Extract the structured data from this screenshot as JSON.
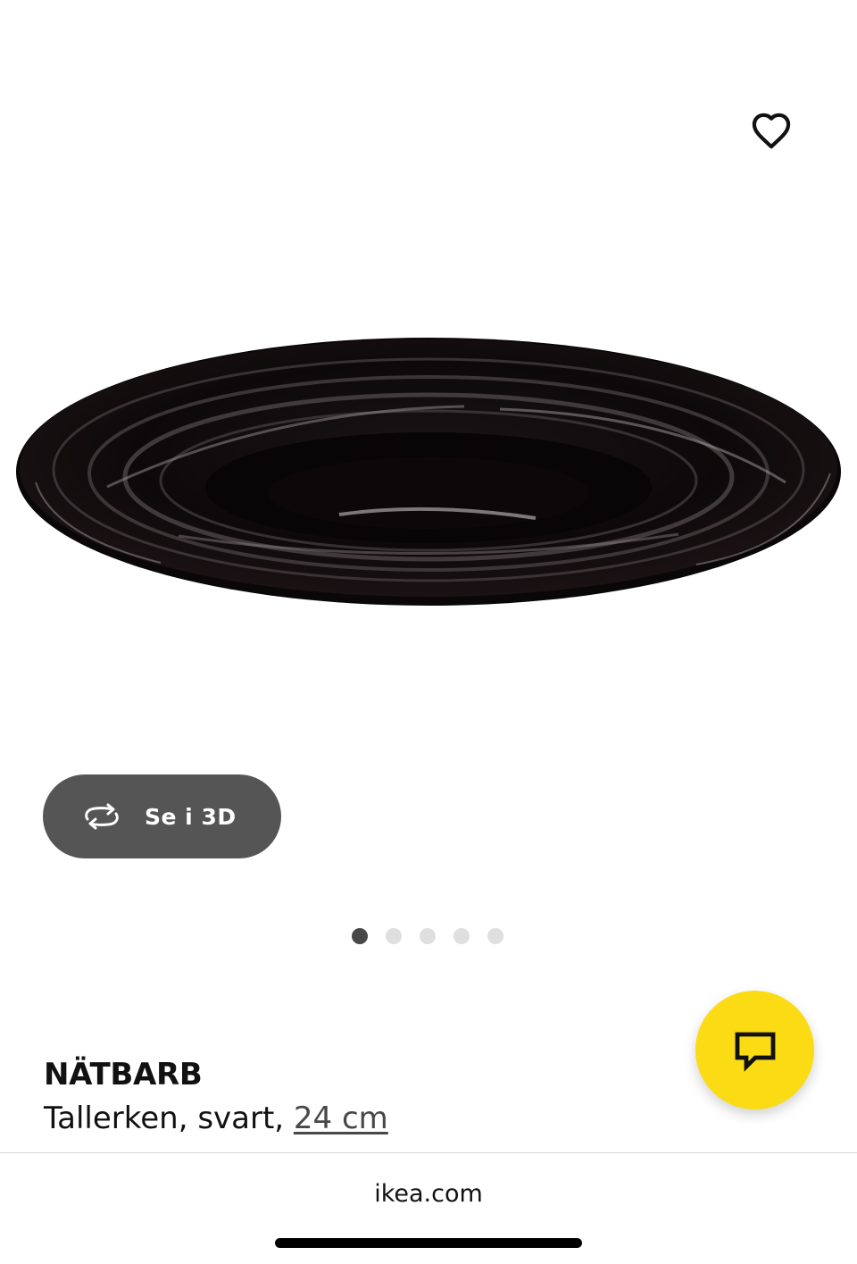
{
  "product": {
    "name": "NÄTBARB",
    "description_prefix": "Tallerken, svart, ",
    "size_link": "24 cm"
  },
  "gallery": {
    "view_3d_label": "Se i 3D",
    "total_images": 5,
    "active_index": 0
  },
  "icons": {
    "favorite": "heart-outline-icon",
    "view_3d": "rotate-arrows-icon",
    "chat": "chat-bubble-icon"
  },
  "browser": {
    "url": "ikea.com"
  },
  "colors": {
    "chat_button": "#fadb14",
    "view_3d_button": "#555555",
    "dot_active": "#484848",
    "dot_inactive": "#dfdfdf"
  }
}
